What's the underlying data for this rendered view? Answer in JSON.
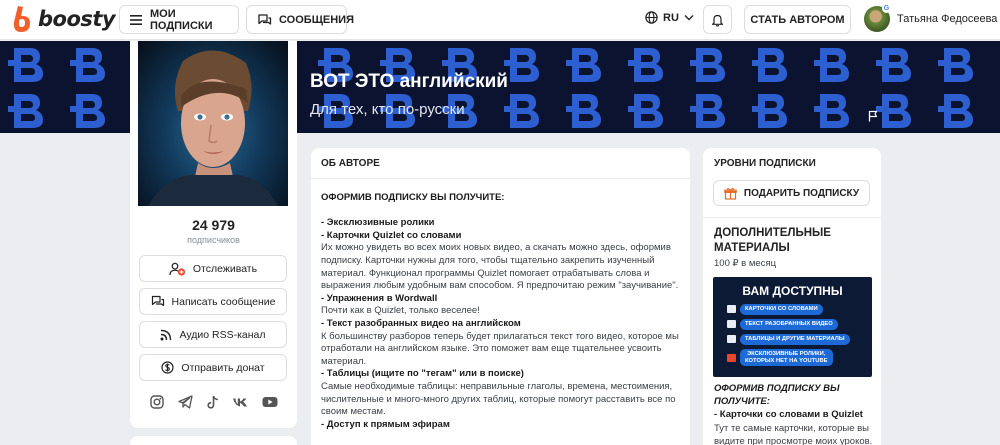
{
  "header": {
    "brand": "boosty",
    "my_subscriptions": "МОИ ПОДПИСКИ",
    "messages": "СООБЩЕНИЯ",
    "language": "RU",
    "become_author": "СТАТЬ АВТОРОМ",
    "user_name": "Татьяна Федосеева",
    "avatar_badge": "G"
  },
  "banner": {
    "title": "ВОТ ЭТО английский",
    "subtitle": "Для тех, кто по-русски"
  },
  "profile": {
    "subscribers_count": "24 979",
    "subscribers_label": "подписчиков",
    "follow": "Отслеживать",
    "write_message": "Написать сообщение",
    "audio_rss": "Аудио RSS-канал",
    "send_donation": "Отправить донат",
    "socials": [
      "instagram-icon",
      "telegram-icon",
      "tiktok-icon",
      "vk-icon",
      "youtube-icon"
    ]
  },
  "about": {
    "heading": "ОБ АВТОРЕ",
    "intro": "ОФОРМИВ ПОДПИСКУ ВЫ ПОЛУЧИТЕ:",
    "item_exclusive": "- Эксклюзивные ролики",
    "item_quizlet": "- Карточки Quizlet со словами",
    "quizlet_text": "Их можно увидеть во всех моих новых видео, а скачать можно здесь, оформив подписку. Карточки нужны для того, чтобы тщательно закрепить изученный материал. Функционал программы Quizlet помогает отрабатывать слова и выражения любым удобным вам способом. Я предпочитаю режим \"заучивание\".",
    "item_wordwall": " - Упражнения в Wordwall",
    "wordwall_text": "Почти как в Quizlet, только веселее!",
    "item_texts": "- Текст разобранных видео на английском",
    "texts_text": "К большинству разборов теперь будет прилагаться текст того видео, которое мы отработали на английском языке. Это поможет вам еще тщательнее усвоить материал.",
    "item_tables": "- Таблицы (ищите по \"тегам\" или в поиске)",
    "tables_text": "Самые необходимые таблицы: неправильные глаголы, времена, местоимения, числительные и много-много других таблиц, которые помогут расставить все по своим местам.",
    "item_streams": "-  Доступ к прямым эфирам"
  },
  "levels": {
    "heading": "УРОВНИ ПОДПИСКИ",
    "gift_button": "ПОДАРИТЬ ПОДПИСКУ",
    "tier_title": "ДОПОЛНИТЕЛЬНЫЕ МАТЕРИАЛЫ",
    "tier_price": "100 ₽ в месяц",
    "promo_title": "ВАМ ДОСТУПНЫ",
    "promo_items": [
      "КАРТОЧКИ СО СЛОВАМИ",
      "ТЕКСТ РАЗОБРАННЫХ ВИДЕО",
      "ТАБЛИЦЫ И ДРУГИЕ МАТЕРИАЛЫ",
      "ЭКСКЛЮЗИВНЫЕ РОЛИКИ,",
      "КОТОРЫХ НЕТ НА YOUTUBE"
    ],
    "tier_sub_heading": "ОФОРМИВ ПОДПИСКУ ВЫ ПОЛУЧИТЕ:",
    "tier_item_title": "- Карточки со словами в Quizlet",
    "tier_item_text": "Тут те самые карточки, которые вы видите при просмотре моих уроков."
  },
  "colors": {
    "brand_orange": "#f15f2c",
    "banner_navy": "#0b1330",
    "promo_blue": "#1d6ad6"
  }
}
